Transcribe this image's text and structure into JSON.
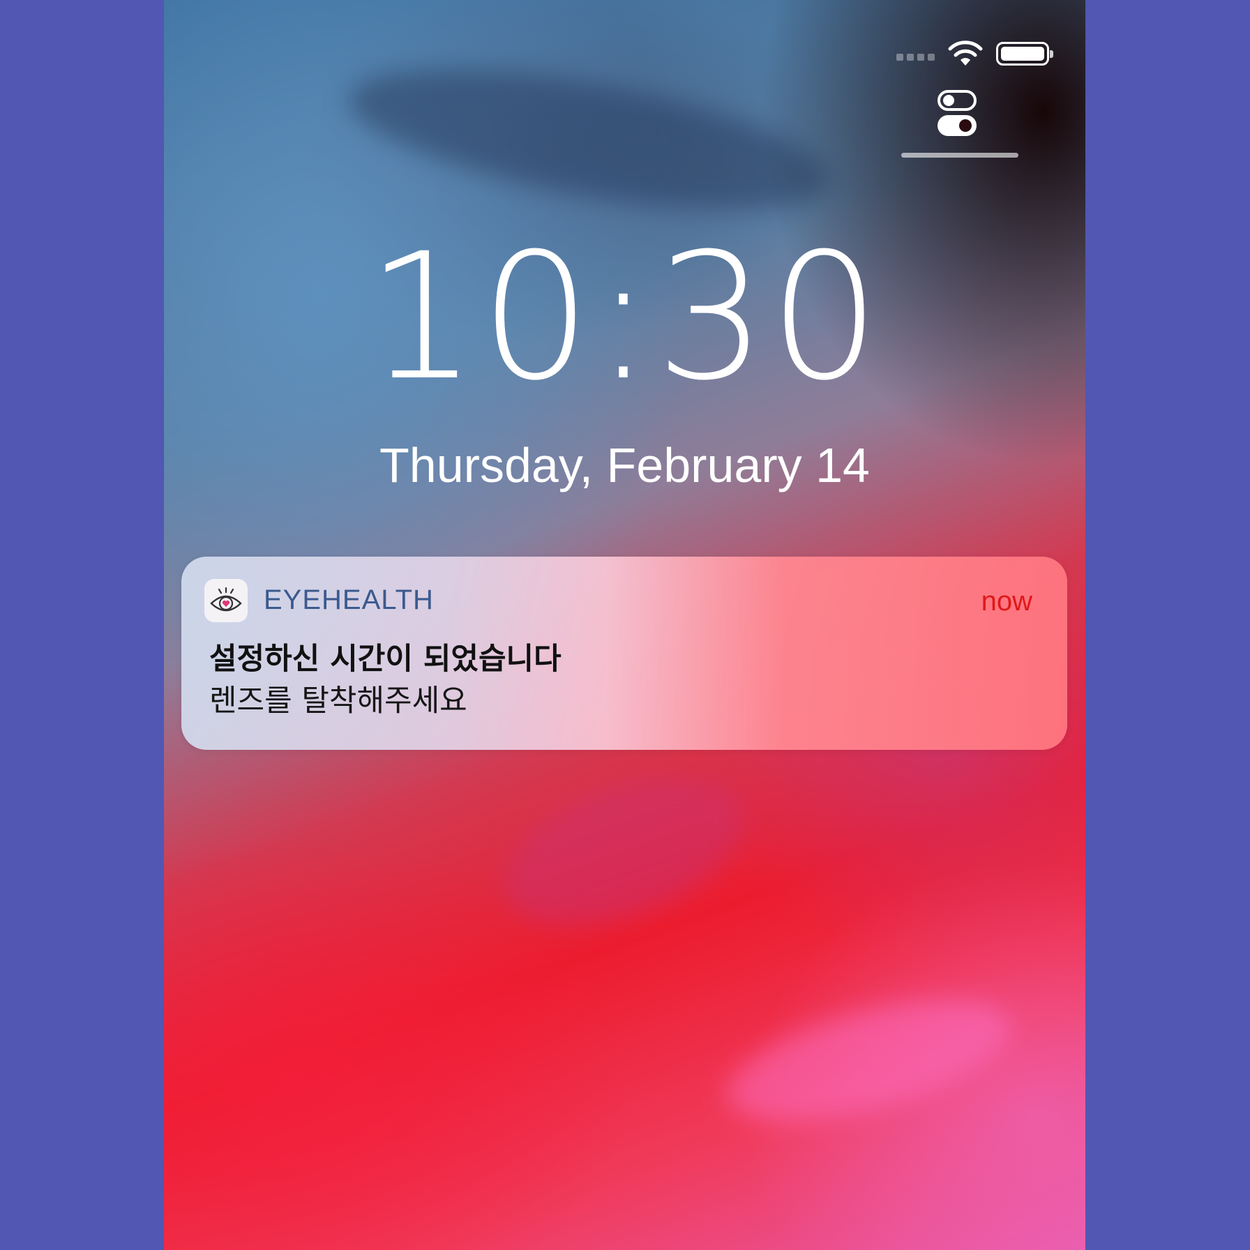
{
  "status_bar": {
    "signal_icon": "cellular-signal-dots",
    "wifi_icon": "wifi-icon",
    "battery_icon": "battery-icon",
    "battery_level": 1.0
  },
  "controls": {
    "toggle_icon": "toggle-switches-icon"
  },
  "lock_screen": {
    "time": "10:30",
    "date": "Thursday, February 14"
  },
  "notification": {
    "app_icon": "eye-heart-icon",
    "app_name": "EYEHEALTH",
    "time": "now",
    "title": "설정하신 시간이 되었습니다",
    "body": "렌즈를 탈착해주세요"
  },
  "colors": {
    "background": "#5157B3",
    "notification_time": "#e01818",
    "app_name": "#3b5a8e"
  }
}
